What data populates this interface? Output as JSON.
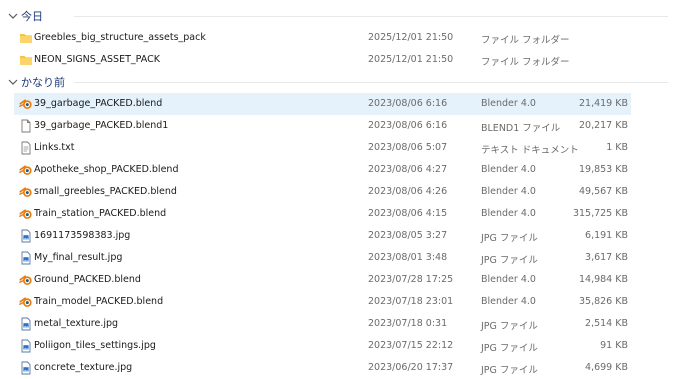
{
  "groups": [
    {
      "title": "今日",
      "files": [
        {
          "icon": "folder-icon",
          "name": "Greebles_big_structure_assets_pack",
          "date": "2025/12/01 21:50",
          "type": "ファイル フォルダー",
          "size": ""
        },
        {
          "icon": "folder-icon",
          "name": "NEON_SIGNS_ASSET_PACK",
          "date": "2025/12/01 21:50",
          "type": "ファイル フォルダー",
          "size": ""
        }
      ]
    },
    {
      "title": "かなり前",
      "files": [
        {
          "icon": "blender-icon",
          "name": "39_garbage_PACKED.blend",
          "date": "2023/08/06 6:16",
          "type": "Blender 4.0",
          "size": "21,419 KB",
          "selected": true
        },
        {
          "icon": "file-icon",
          "name": "39_garbage_PACKED.blend1",
          "date": "2023/08/06 6:16",
          "type": "BLEND1 ファイル",
          "size": "20,217 KB"
        },
        {
          "icon": "text-file-icon",
          "name": "Links.txt",
          "date": "2023/08/06 5:07",
          "type": "テキスト ドキュメント",
          "size": "1 KB"
        },
        {
          "icon": "blender-icon",
          "name": "Apotheke_shop_PACKED.blend",
          "date": "2023/08/06 4:27",
          "type": "Blender 4.0",
          "size": "19,853 KB"
        },
        {
          "icon": "blender-icon",
          "name": "small_greebles_PACKED.blend",
          "date": "2023/08/06 4:26",
          "type": "Blender 4.0",
          "size": "49,567 KB"
        },
        {
          "icon": "blender-icon",
          "name": "Train_station_PACKED.blend",
          "date": "2023/08/06 4:15",
          "type": "Blender 4.0",
          "size": "315,725 KB"
        },
        {
          "icon": "image-file-icon",
          "name": "1691173598383.jpg",
          "date": "2023/08/05 3:27",
          "type": "JPG ファイル",
          "size": "6,191 KB"
        },
        {
          "icon": "image-file-icon",
          "name": "My_final_result.jpg",
          "date": "2023/08/01 3:48",
          "type": "JPG ファイル",
          "size": "3,617 KB"
        },
        {
          "icon": "blender-icon",
          "name": "Ground_PACKED.blend",
          "date": "2023/07/28 17:25",
          "type": "Blender 4.0",
          "size": "14,984 KB"
        },
        {
          "icon": "blender-icon",
          "name": "Train_model_PACKED.blend",
          "date": "2023/07/18 23:01",
          "type": "Blender 4.0",
          "size": "35,826 KB"
        },
        {
          "icon": "image-file-icon",
          "name": "metal_texture.jpg",
          "date": "2023/07/18 0:31",
          "type": "JPG ファイル",
          "size": "2,514 KB"
        },
        {
          "icon": "image-file-icon",
          "name": "Poliigon_tiles_settings.jpg",
          "date": "2023/07/15 22:12",
          "type": "JPG ファイル",
          "size": "91 KB"
        },
        {
          "icon": "image-file-icon",
          "name": "concrete_texture.jpg",
          "date": "2023/06/20 17:37",
          "type": "JPG ファイル",
          "size": "4,699 KB"
        }
      ]
    }
  ],
  "colors": {
    "selection": "#e5f1fb",
    "folder": "#f6c344",
    "blender_orange": "#e87d0d",
    "blender_blue": "#265787",
    "header_text": "#1e3a78"
  }
}
